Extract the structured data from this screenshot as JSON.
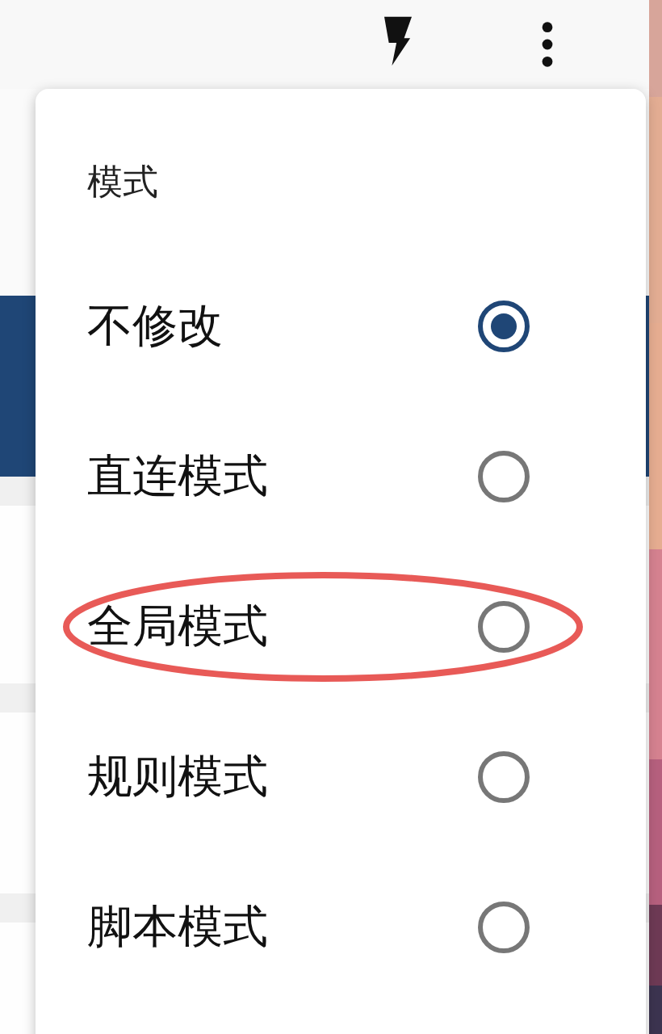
{
  "menu": {
    "title": "模式",
    "options": [
      {
        "label": "不修改",
        "selected": true,
        "circled": false
      },
      {
        "label": "直连模式",
        "selected": false,
        "circled": false
      },
      {
        "label": "全局模式",
        "selected": false,
        "circled": true
      },
      {
        "label": "规则模式",
        "selected": false,
        "circled": false
      },
      {
        "label": "脚本模式",
        "selected": false,
        "circled": false
      }
    ]
  }
}
